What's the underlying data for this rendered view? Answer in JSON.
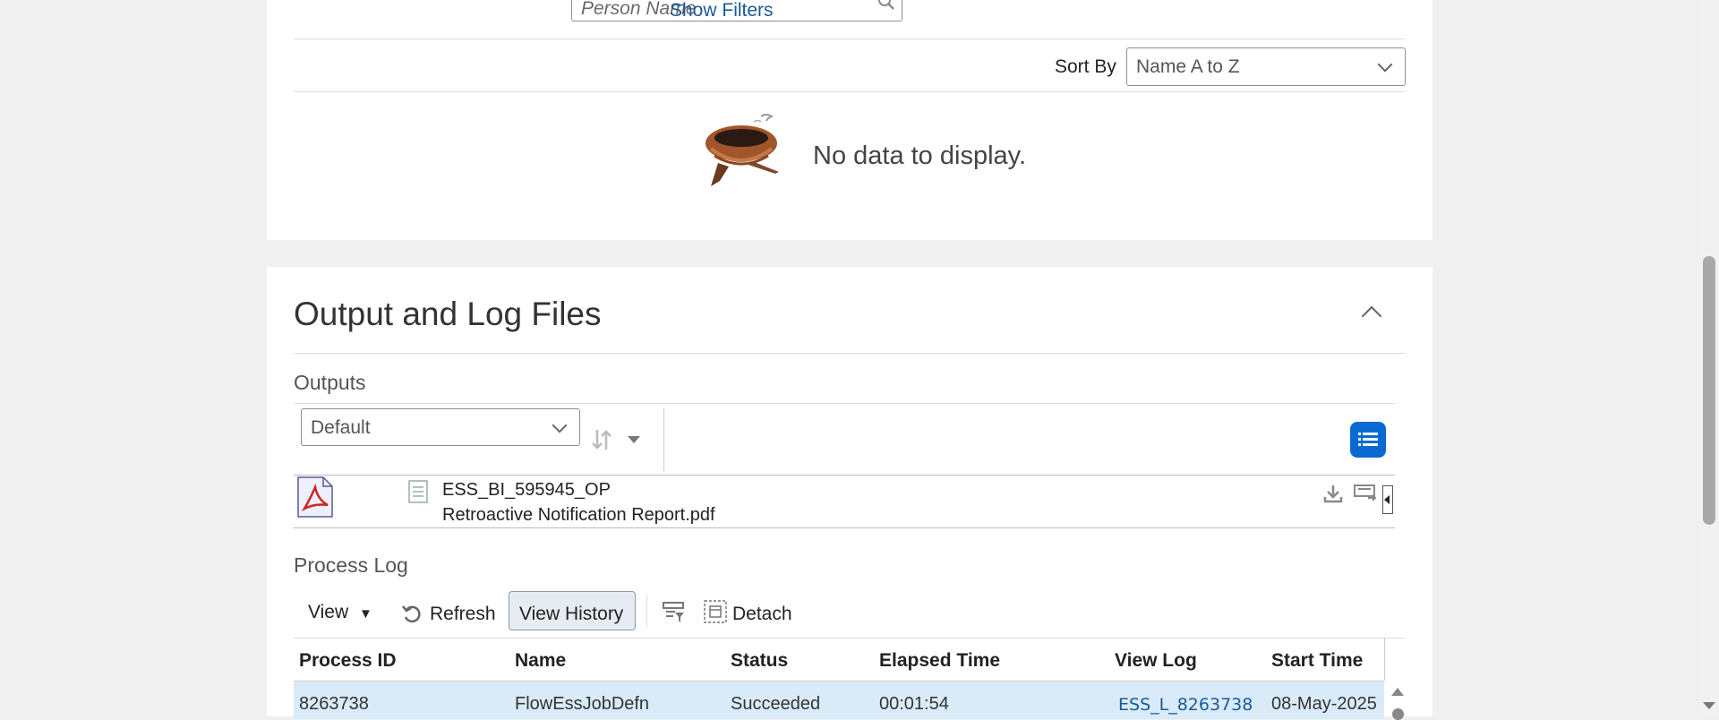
{
  "filters": {
    "search_placeholder": "Person Name",
    "show_filters": "Show Filters",
    "sort_by_label": "Sort By",
    "sort_by_value": "Name A to Z"
  },
  "empty_state": {
    "message": "No data to display."
  },
  "output_section": {
    "title": "Output and Log Files",
    "outputs_label": "Outputs",
    "view_select": "Default",
    "file": {
      "name": "ESS_BI_595945_OP",
      "report": "Retroactive Notification Report.pdf"
    }
  },
  "process_log": {
    "title": "Process Log",
    "toolbar": {
      "view": "View",
      "refresh": "Refresh",
      "view_history": "View History",
      "detach": "Detach"
    },
    "columns": [
      "Process ID",
      "Name",
      "Status",
      "Elapsed Time",
      "View Log",
      "Start Time"
    ],
    "rows": [
      {
        "process_id": "8263738",
        "name": "FlowEssJobDefn",
        "status": "Succeeded",
        "elapsed": "00:01:54",
        "view_log": "ESS_L_8263738",
        "start_time": "08-May-2025"
      }
    ]
  },
  "colors": {
    "accent": "#0a6ad1",
    "link": "#1a5a96",
    "selected_row": "#d9ebf9"
  }
}
